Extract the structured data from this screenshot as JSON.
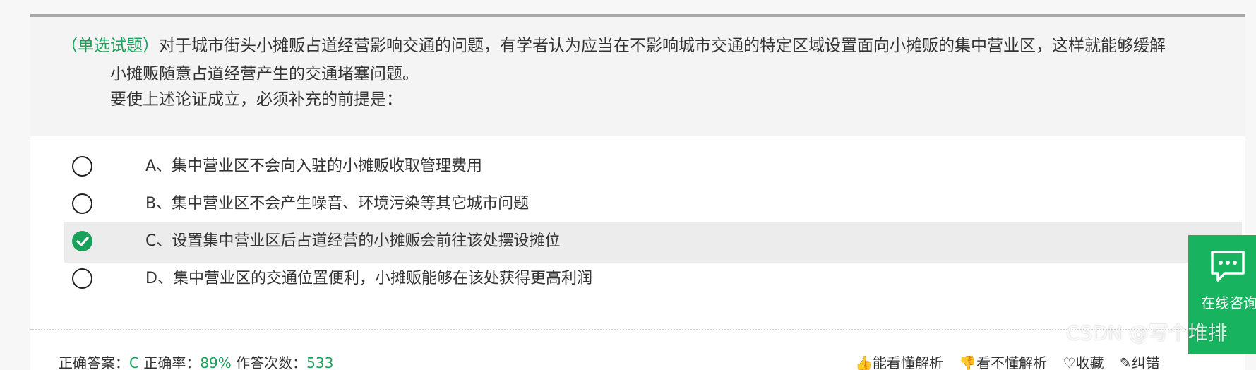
{
  "question": {
    "tag": "（单选试题）",
    "line1": "对于城市街头小摊贩占道经营影响交通的问题，有学者认为应当在不影响城市交通的特定区域设置面向小摊贩的集中营业区，这样就能够缓解",
    "line2": "小摊贩随意占道经营产生的交通堵塞问题。",
    "line3": "要使上述论证成立，必须补充的前提是："
  },
  "options": [
    {
      "text": "A、集中营业区不会向入驻的小摊贩收取管理费用",
      "selected": false
    },
    {
      "text": "B、集中营业区不会产生噪音、环境污染等其它城市问题",
      "selected": false
    },
    {
      "text": "C、设置集中营业区后占道经营的小摊贩会前往该处摆设摊位",
      "selected": true
    },
    {
      "text": "D、集中营业区的交通位置便利，小摊贩能够在该处获得更高利润",
      "selected": false
    }
  ],
  "footer": {
    "answer_label": "正确答案：",
    "answer_value": "C",
    "rate_label": "正确率：",
    "rate_value": "89%",
    "count_label": "作答次数：",
    "count_value": "533",
    "action_understand": "能看懂解析",
    "action_not_understand": "看不懂解析",
    "action_favorite": "收藏",
    "action_report": "纠错"
  },
  "consult": {
    "label": "在线咨询"
  },
  "watermark": "CSDN @写个堆排",
  "colors": {
    "accent": "#19a05a",
    "consult_bg": "#17b35f"
  }
}
